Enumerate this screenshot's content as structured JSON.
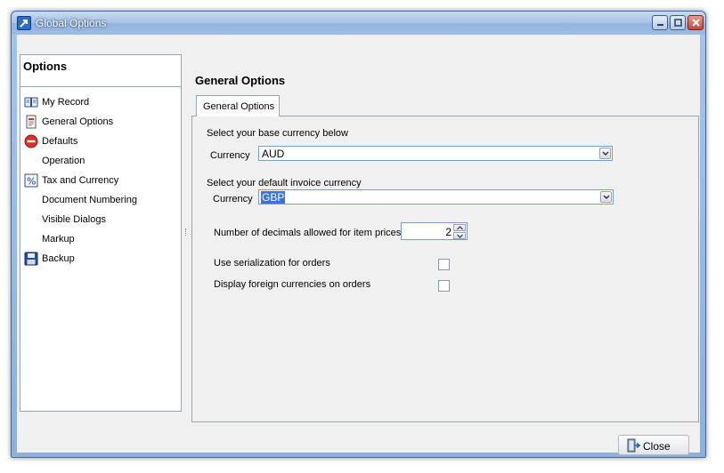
{
  "window": {
    "title": "Global Options",
    "controls": {
      "minimize": "minimize-icon",
      "maximize": "maximize-icon",
      "close": "close-icon"
    }
  },
  "sidebar": {
    "header": "Options",
    "items": [
      {
        "label": "My Record",
        "icon": "book-icon"
      },
      {
        "label": "General Options",
        "icon": "document-icon"
      },
      {
        "label": "Defaults",
        "icon": "no-entry-icon"
      },
      {
        "label": "Operation",
        "icon": ""
      },
      {
        "label": "Tax and Currency",
        "icon": "percent-icon"
      },
      {
        "label": "Document Numbering",
        "icon": ""
      },
      {
        "label": "Visible Dialogs",
        "icon": ""
      },
      {
        "label": "Markup",
        "icon": ""
      },
      {
        "label": "Backup",
        "icon": "floppy-disk-icon"
      }
    ]
  },
  "main": {
    "title": "General Options",
    "tab_label": "General Options",
    "base_currency": {
      "heading": "Select your base currency below",
      "label": "Currency",
      "value": "AUD"
    },
    "invoice_currency": {
      "heading": "Select your default invoice currency",
      "label": "Currency",
      "value": "GBP"
    },
    "decimals": {
      "label": "Number of decimals allowed for item prices",
      "value": "2"
    },
    "serialization": {
      "label": "Use serialization for orders",
      "checked": false
    },
    "foreign_currencies": {
      "label": "Display foreign currencies on orders",
      "checked": false
    }
  },
  "footer": {
    "close_label": "Close",
    "close_icon": "exit-door-icon"
  },
  "colors": {
    "accent": "#3875d7",
    "titlebar": "#a8c3e6",
    "close_button": "#c74632"
  }
}
